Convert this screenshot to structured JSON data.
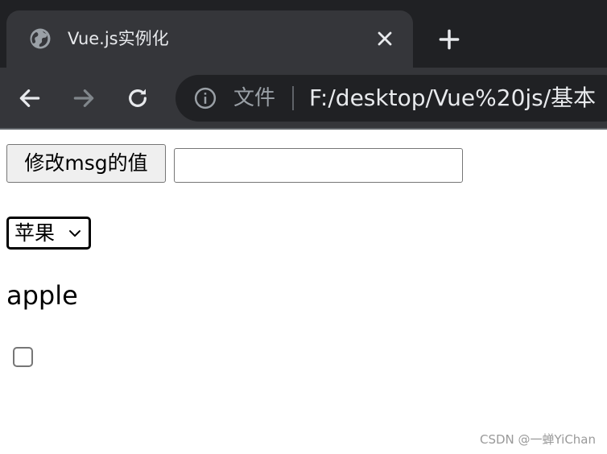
{
  "tab": {
    "title": "Vue.js实例化",
    "favicon": "globe-icon"
  },
  "toolbar": {
    "back": "arrow-left-icon",
    "forward": "arrow-right-icon",
    "reload": "reload-icon"
  },
  "omnibox": {
    "scheme_label": "文件",
    "url": "F:/desktop/Vue%20js/基本"
  },
  "page": {
    "button_label": "修改msg的值",
    "input_value": "",
    "select": {
      "selected": "苹果"
    },
    "fruit_value": "apple",
    "checkbox_checked": false
  },
  "watermark": "CSDN @一蝉YiChan",
  "colors": {
    "tabstrip": "#202124",
    "toolbar": "#35363a",
    "omnibox": "#202124",
    "chrome_text": "#e8eaed",
    "chrome_muted": "#9aa0a6"
  }
}
